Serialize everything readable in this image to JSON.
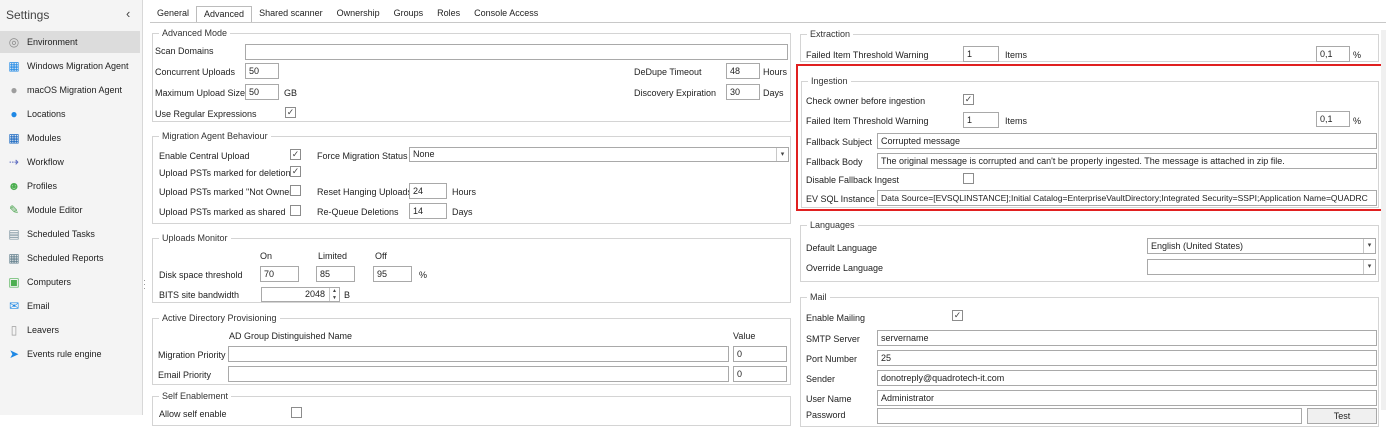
{
  "sidebar": {
    "title": "Settings",
    "collapse_icon": "chevron-left-icon",
    "items": [
      {
        "label": "Environment",
        "icon": "globe-icon",
        "color": "#8a8a8a"
      },
      {
        "label": "Windows Migration Agent",
        "icon": "windows-icon",
        "color": "#1e88e5"
      },
      {
        "label": "macOS Migration Agent",
        "icon": "apple-icon",
        "color": "#9e9e9e"
      },
      {
        "label": "Locations",
        "icon": "location-icon",
        "color": "#1e88e5"
      },
      {
        "label": "Modules",
        "icon": "modules-icon",
        "color": "#1565c0"
      },
      {
        "label": "Workflow",
        "icon": "workflow-icon",
        "color": "#5c6bc0"
      },
      {
        "label": "Profiles",
        "icon": "profiles-icon",
        "color": "#4caf50"
      },
      {
        "label": "Module Editor",
        "icon": "module-editor-icon",
        "color": "#43a047"
      },
      {
        "label": "Scheduled Tasks",
        "icon": "scheduled-tasks-icon",
        "color": "#78909c"
      },
      {
        "label": "Scheduled Reports",
        "icon": "calendar-icon",
        "color": "#607d8b"
      },
      {
        "label": "Computers",
        "icon": "computers-icon",
        "color": "#4caf50"
      },
      {
        "label": "Email",
        "icon": "email-icon",
        "color": "#1e88e5"
      },
      {
        "label": "Leavers",
        "icon": "leavers-icon",
        "color": "#9e9e9e"
      },
      {
        "label": "Events rule engine",
        "icon": "events-icon",
        "color": "#1e88e5"
      }
    ]
  },
  "tabs": [
    "General",
    "Advanced",
    "Shared scanner",
    "Ownership",
    "Groups",
    "Roles",
    "Console Access"
  ],
  "advanced_mode": {
    "title": "Advanced Mode",
    "scan_domains_label": "Scan Domains",
    "scan_domains_value": "",
    "concurrent_uploads_label": "Concurrent Uploads",
    "concurrent_uploads_value": "50",
    "max_upload_label": "Maximum Upload Size",
    "max_upload_value": "50",
    "max_upload_unit": "GB",
    "use_regex_label": "Use Regular Expressions",
    "dedupe_label": "DeDupe Timeout",
    "dedupe_value": "48",
    "dedupe_unit": "Hours",
    "discovery_label": "Discovery Expiration",
    "discovery_value": "30",
    "discovery_unit": "Days"
  },
  "migration_agent": {
    "title": "Migration Agent Behaviour",
    "enable_central_label": "Enable Central Upload",
    "upload_deletion_label": "Upload PSTs marked for deletion",
    "upload_not_owner_label": "Upload PSTs marked \"Not Owner\"",
    "upload_shared_label": "Upload PSTs marked as shared",
    "force_label": "Force Migration Status",
    "force_value": "None",
    "reset_label": "Reset Hanging Uploads",
    "reset_value": "24",
    "reset_unit": "Hours",
    "requeue_label": "Re-Queue Deletions",
    "requeue_value": "14",
    "requeue_unit": "Days"
  },
  "uploads_monitor": {
    "title": "Uploads Monitor",
    "col_on": "On",
    "col_limited": "Limited",
    "col_off": "Off",
    "disk_label": "Disk space threshold",
    "disk_on": "70",
    "disk_limited": "85",
    "disk_off": "95",
    "disk_unit": "%",
    "bits_label": "BITS site bandwidth",
    "bits_value": "2048",
    "bits_unit": "B"
  },
  "ad_provisioning": {
    "title": "Active Directory Provisioning",
    "col_dn": "AD Group Distinguished Name",
    "col_value": "Value",
    "migration_priority_label": "Migration Priority",
    "migration_priority_value": "0",
    "email_priority_label": "Email Priority",
    "email_priority_value": "0"
  },
  "self_enablement": {
    "title": "Self Enablement",
    "allow_label": "Allow self enable"
  },
  "extraction": {
    "title": "Extraction",
    "threshold_label": "Failed Item Threshold Warning",
    "threshold_value": "1",
    "threshold_unit": "Items",
    "percent_value": "0,1",
    "percent_unit": "%"
  },
  "ingestion": {
    "title": "Ingestion",
    "check_owner_label": "Check owner before ingestion",
    "threshold_label": "Failed Item Threshold Warning",
    "threshold_value": "1",
    "threshold_unit": "Items",
    "percent_value": "0,1",
    "percent_unit": "%",
    "fallback_subject_label": "Fallback Subject",
    "fallback_subject_value": "Corrupted message",
    "fallback_body_label": "Fallback Body",
    "fallback_body_value": "The original message is corrupted and can't be properly ingested. The message is attached in zip file.",
    "disable_fallback_label": "Disable Fallback Ingest",
    "ev_sql_label": "EV SQL Instance",
    "ev_sql_value": "Data Source=[EVSQLINSTANCE];Initial Catalog=EnterpriseVaultDirectory;Integrated Security=SSPI;Application Name=QUADRC"
  },
  "languages": {
    "title": "Languages",
    "default_label": "Default Language",
    "default_value": "English (United States)",
    "override_label": "Override Language",
    "override_value": ""
  },
  "mail": {
    "title": "Mail",
    "enable_label": "Enable Mailing",
    "smtp_label": "SMTP Server",
    "smtp_value": "servername",
    "port_label": "Port Number",
    "port_value": "25",
    "sender_label": "Sender",
    "sender_value": "donotreply@quadrotech-it.com",
    "username_label": "User Name",
    "username_value": "Administrator",
    "password_label": "Password",
    "test_label": "Test"
  },
  "colors": {
    "highlight": "#e02020",
    "active_nav": "#dcdcdc"
  }
}
